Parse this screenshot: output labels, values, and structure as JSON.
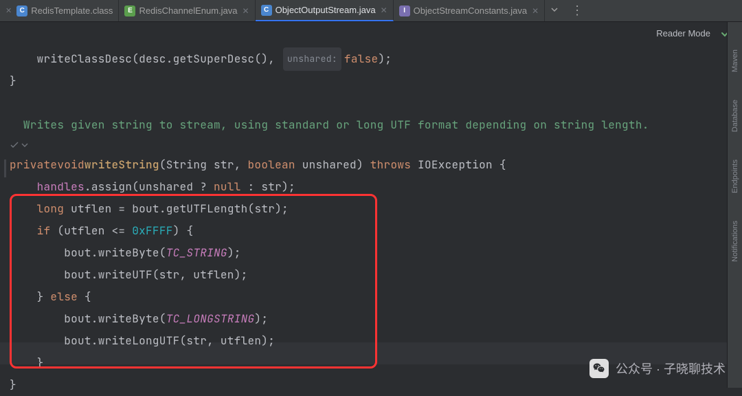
{
  "tabs": [
    {
      "icon": "C",
      "iconClass": "c-class",
      "label": "RedisTemplate.class",
      "active": false
    },
    {
      "icon": "E",
      "iconClass": "e-enum",
      "label": "RedisChannelEnum.java",
      "active": false
    },
    {
      "icon": "C",
      "iconClass": "c-class",
      "label": "ObjectOutputStream.java",
      "active": true
    },
    {
      "icon": "I",
      "iconClass": "i-interface",
      "label": "ObjectStreamConstants.java",
      "active": false
    }
  ],
  "reader_bar": {
    "label": "Reader Mode"
  },
  "right_tools": [
    "Maven",
    "Database",
    "Endpoints",
    "Notifications"
  ],
  "doc": {
    "text": "Writes given string to stream, using standard or long UTF format depending on string length."
  },
  "code": {
    "l1_pre": "    writeClassDesc(desc.getSuperDesc(), ",
    "l1_hint": "unshared:",
    "l1_false": "false",
    "l1_post": ");",
    "l2": "}",
    "sig_private": "private",
    "sig_void": "void",
    "sig_name": "writeString",
    "sig_open": "(String str, ",
    "sig_boolean": "boolean",
    "sig_unshared": " unshared) ",
    "sig_throws": "throws",
    "sig_ioexc": " IOException {",
    "b1_handles": "handles",
    "b1_assign": ".assign(unshared ? ",
    "b1_null": "null",
    "b1_post": " : str);",
    "b2_long": "long",
    "b2_utflen": " utflen = bout.",
    "b2_getutf": "getUTFLength",
    "b2_post": "(str);",
    "b3_if": "if",
    "b3_cond_pre": " (utflen <= ",
    "b3_hex": "0xFFFF",
    "b3_cond_post": ") {",
    "b4_bout": "bout.writeByte(",
    "b4_tc": "TC_STRING",
    "b4_post": ");",
    "b5_bout": "bout.writeUTF(str, utflen);",
    "b6_close": "} ",
    "b6_else": "else",
    "b6_open": " {",
    "b7_bout": "bout.writeByte(",
    "b7_tc": "TC_LONGSTRING",
    "b7_post": ");",
    "b8_bout": "bout.writeLongUTF(str, utflen);",
    "b9": "}",
    "close": "}"
  },
  "watermark": {
    "label": "公众号 · 子晓聊技术"
  }
}
